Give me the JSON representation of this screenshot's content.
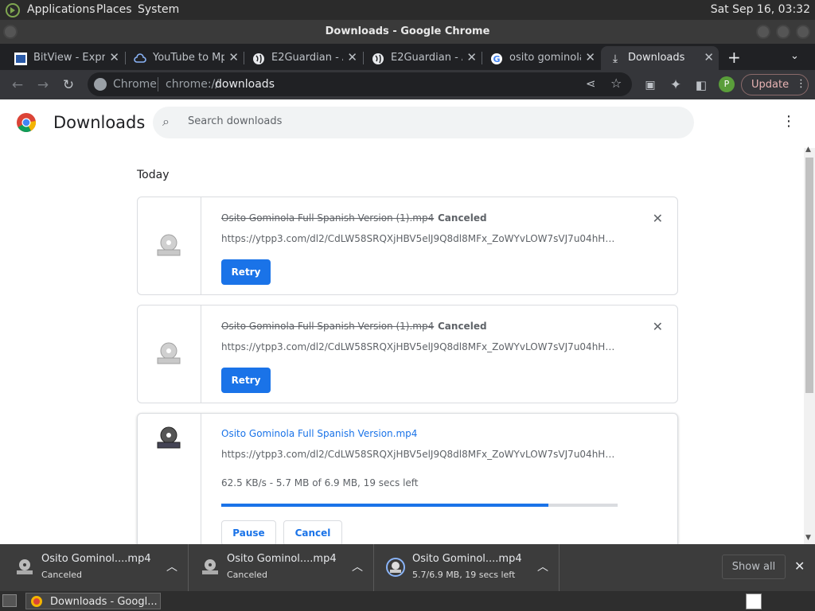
{
  "system": {
    "menu": [
      "Applications",
      "Places",
      "System"
    ],
    "clock": "Sat Sep 16, 03:32"
  },
  "window": {
    "title": "Downloads - Google Chrome"
  },
  "tabs": [
    {
      "label": "BitView - Expr",
      "icon": "bitview-icon",
      "active": false
    },
    {
      "label": "YouTube to Mp",
      "icon": "cloud-icon",
      "active": false
    },
    {
      "label": "E2Guardian - A",
      "icon": "globe-icon",
      "active": false
    },
    {
      "label": "E2Guardian - A",
      "icon": "globe-icon",
      "active": false
    },
    {
      "label": "osito gominola",
      "icon": "google-icon",
      "active": false
    },
    {
      "label": "Downloads",
      "icon": "download-icon",
      "active": true
    }
  ],
  "toolbar": {
    "site_chip": "Chrome",
    "url_prefix": "chrome://",
    "url_path": "downloads",
    "profile_initial": "P",
    "update_label": "Update"
  },
  "page": {
    "title": "Downloads",
    "search_placeholder": "Search downloads",
    "section_heading": "Today"
  },
  "downloads": [
    {
      "filename": "Osito Gominola Full Spanish Version (1).mp4",
      "status": "Canceled",
      "url": "https://ytpp3.com/dl2/CdLW58SRQXjHBV5elJ9Q8dl8MFx_ZoWYvLOW7sVJ7u04hHv...",
      "action": "Retry"
    },
    {
      "filename": "Osito Gominola Full Spanish Version (1).mp4",
      "status": "Canceled",
      "url": "https://ytpp3.com/dl2/CdLW58SRQXjHBV5elJ9Q8dl8MFx_ZoWYvLOW7sVJ7u04hHv...",
      "action": "Retry"
    },
    {
      "filename": "Osito Gominola Full Spanish Version.mp4",
      "url": "https://ytpp3.com/dl2/CdLW58SRQXjHBV5elJ9Q8dl8MFx_ZoWYvLOW7sVJ7u04hHv...",
      "progress_text": "62.5 KB/s - 5.7 MB of 6.9 MB, 19 secs left",
      "progress_fraction": 0.826,
      "pause_label": "Pause",
      "cancel_label": "Cancel"
    }
  ],
  "shelf": {
    "items": [
      {
        "name": "Osito Gominol....mp4",
        "status": "Canceled"
      },
      {
        "name": "Osito Gominol....mp4",
        "status": "Canceled"
      },
      {
        "name": "Osito Gominol....mp4",
        "status": "5.7/6.9 MB, 19 secs left"
      }
    ],
    "show_all_label": "Show all"
  },
  "taskbar": {
    "item_label": "Downloads - Googl..."
  },
  "colors": {
    "accent": "#1a73e8",
    "tab_bg": "#202124",
    "toolbar_bg": "#35363a",
    "profile": "#5a9e3a"
  }
}
